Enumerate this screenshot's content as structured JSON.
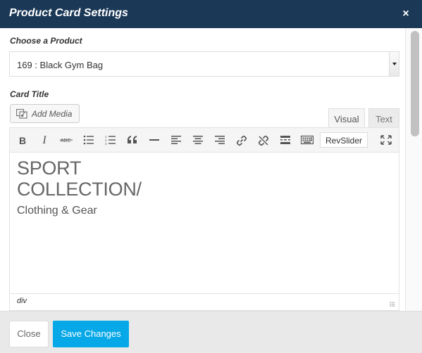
{
  "modal": {
    "title": "Product Card Settings",
    "close_glyph": "×"
  },
  "product": {
    "label": "Choose a Product",
    "selected": "169 : Black Gym Bag"
  },
  "card_title": {
    "label": "Card Title",
    "add_media_label": "Add Media"
  },
  "editor": {
    "tabs": [
      {
        "label": "Visual",
        "active": true
      },
      {
        "label": "Text",
        "active": false
      }
    ],
    "toolbar": {
      "bold": "B",
      "italic": "I",
      "revslider": "RevSlider"
    },
    "content": {
      "heading_line1": "SPORT",
      "heading_line2": "COLLECTION/",
      "subheading": "Clothing & Gear"
    },
    "status_path": "div"
  },
  "footer": {
    "close_label": "Close",
    "save_label": "Save Changes"
  },
  "colors": {
    "header_bg": "#1b3857",
    "save_bg": "#06a8e8"
  }
}
